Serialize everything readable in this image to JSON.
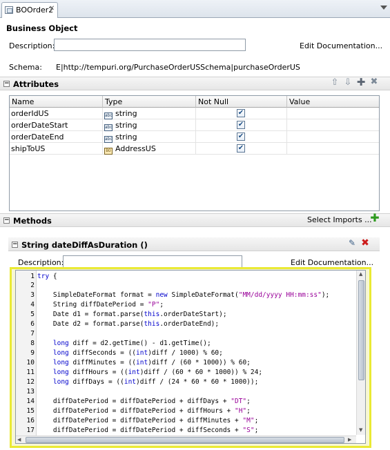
{
  "tab": {
    "title": "BOOrder2"
  },
  "business_object": {
    "section_title": "Business Object",
    "description_label": "Description:",
    "description_value": "",
    "edit_documentation": "Edit Documentation...",
    "schema_label": "Schema:",
    "schema_value": "E|http://tempuri.org/PurchaseOrderUSSchema|purchaseOrderUS"
  },
  "attributes": {
    "section_title": "Attributes",
    "columns": [
      "Name",
      "Type",
      "Not Null",
      "Value"
    ],
    "rows": [
      {
        "name": "orderIdUS",
        "type": "string",
        "type_icon": "string-type-icon",
        "not_null": true,
        "value": ""
      },
      {
        "name": "orderDateStart",
        "type": "string",
        "type_icon": "string-type-icon",
        "not_null": true,
        "value": ""
      },
      {
        "name": "orderDateEnd",
        "type": "string",
        "type_icon": "string-type-icon",
        "not_null": true,
        "value": ""
      },
      {
        "name": "shipToUS",
        "type": "AddressUS",
        "type_icon": "business-object-icon",
        "not_null": true,
        "value": ""
      }
    ]
  },
  "methods": {
    "section_title": "Methods",
    "select_imports": "Select Imports ...",
    "method": {
      "signature": "String dateDiffAsDuration ()",
      "description_label": "Description:",
      "description_value": "",
      "edit_documentation": "Edit Documentation..."
    }
  },
  "code": {
    "line_numbers": [
      "1",
      "2",
      "3",
      "4",
      "5",
      "6",
      "7",
      "8",
      "9",
      "10",
      "11",
      "12",
      "13",
      "14",
      "15",
      "16",
      "17"
    ],
    "lines": [
      "try {",
      "",
      "    SimpleDateFormat format = new SimpleDateFormat(\"MM/dd/yyyy HH:mm:ss\");",
      "    String diffDatePeriod = \"P\";",
      "    Date d1 = format.parse(this.orderDateStart);",
      "    Date d2 = format.parse(this.orderDateEnd);",
      "",
      "    long diff = d2.getTime() - d1.getTime();",
      "    long diffSeconds = ((int)diff / 1000) % 60;",
      "    long diffMinutes = ((int)diff / (60 * 1000)) % 60;",
      "    long diffHours = ((int)diff / (60 * 60 * 1000)) % 24;",
      "    long diffDays = ((int)diff / (24 * 60 * 60 * 1000));",
      "",
      "    diffDatePeriod = diffDatePeriod + diffDays + \"DT\";",
      "    diffDatePeriod = diffDatePeriod + diffHours + \"H\";",
      "    diffDatePeriod = diffDatePeriod + diffMinutes + \"M\";",
      "    diffDatePeriod = diffDatePeriod + diffSeconds + \"S\";"
    ]
  },
  "colors": {
    "highlight_border": "#eaea33",
    "keyword": "#0000cc",
    "string_literal": "#990099",
    "add_green": "#2e9a1f",
    "delete_red": "#cc1b1b"
  }
}
